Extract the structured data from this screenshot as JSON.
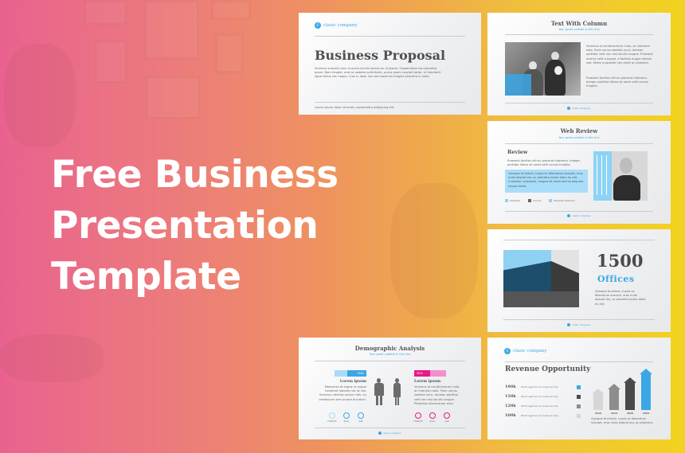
{
  "hero": {
    "title_lines": [
      "Free Business",
      "Presentation",
      "Template"
    ]
  },
  "colors": {
    "accent_blue": "#3ba7e5",
    "accent_pink": "#e8198b",
    "gradient_start": "#e9628f",
    "gradient_end": "#f2d21f"
  },
  "slides": {
    "business_proposal": {
      "logo_text": "clasic company",
      "title": "Business Proposal",
      "body": "Vivamus suscipit nunc ut purus iaculis lacinia eu ut ipsum. Suspendisse non pharetra quam. Nam feugiat, erat ac sodales sollicitudin, purus quam suscipit tortor, in hendrerit ligula tellus nec neque. Cras in dolor non est maximus fringilla pharetra in nulla.",
      "footer": "Lorem ipsum dolor sit amet, consectetur adipiscing elit."
    },
    "text_with_column": {
      "title": "Text With Column",
      "subtitle": "Your great subtitle in this line",
      "paragraph1": "Vivamus at condimentum nulla, ac interdum odio. Proin varius sodales nunc. Aenean porttitor velit non nisl iaculis congue. Praesent viverra velit a augue, a facilisis augue dictum sed. Etiam vulputate non amet ac pharetra.",
      "paragraph2": "Praesent facilisis elit eu placerat interdum. Integer porttitor libero sit amet velit cursus fringilla.",
      "footer_logo": "clasic company"
    },
    "web_review": {
      "title": "Web Review",
      "subtitle": "Your great subtitle in this line",
      "heading": "Review",
      "intro": "Praesent facilisis elit eu placerat interdum. Integer porttitor libero sit amet velit cursus fringilla.",
      "highlight": "Quisque tincidunt, turpis ac bibendum suscipit, eros nulla aliquet dui, ac pharetra lorem diam eu elit. Curabitur vulputate, magna sit amet lacinia aliquam, neque tortor.",
      "legend": [
        "Praesent",
        "Cursus",
        "Placerat interdum"
      ],
      "footer_logo": "clasic company"
    },
    "offices": {
      "number": "1500",
      "label": "Offices",
      "body": "Quisque tincidunt, turpis ac bibendum suscipit, eros nulla aliquet dui, ac pharetra lorem dolor eu elit.",
      "footer_logo": "clasic company"
    },
    "demographic": {
      "title": "Demographic Analysis",
      "subtitle": "Your great subtitle in this line",
      "left": {
        "percent_label": "60%",
        "percent_value": 60,
        "heading": "Lorem ipsum",
        "body": "Maecenas et augue ut augue hendrerit lobortis nec ac est. Vivamus ultricies auctor nibh, eu vestibulum sem ornare tincidunt.",
        "rings": [
          "FINANCE",
          "SKILL",
          "AGE"
        ]
      },
      "right": {
        "percent_label": "50%",
        "percent_value": 50,
        "heading": "Lorem ipsum",
        "body": "Vivamus at condimentum nulla, ac interdum odio. Proin varius sodales nunc. Aenean porttitor velit non nisl iaculis congue. Phasellus ullamcorper eros.",
        "rings": [
          "FINANCE",
          "SKILL",
          "AGE"
        ]
      },
      "footer_logo": "clasic company"
    },
    "revenue": {
      "logo_text": "clasic company",
      "title": "Revenue Opportunity",
      "rows": [
        {
          "value": "190k",
          "text": "Morbi eget leo ac turpis lacinia.",
          "color": "#3ba7e5"
        },
        {
          "value": "150k",
          "text": "Morbi eget leo ac turpis lacinia.",
          "color": "#4a4a4a"
        },
        {
          "value": "120k",
          "text": "Morbi eget leo ac turpis lacinia.",
          "color": "#8d8d8d"
        },
        {
          "value": "100k",
          "text": "Morbi eget leo ac turpis lacinia.",
          "color": "#d6d6d6"
        }
      ],
      "bars": [
        {
          "year": "2018",
          "value": 100,
          "color": "#d6d6d6"
        },
        {
          "year": "2019",
          "value": 120,
          "color": "#8d8d8d"
        },
        {
          "year": "2020",
          "value": 150,
          "color": "#4a4a4a"
        },
        {
          "year": "2020",
          "value": 190,
          "color": "#3ba7e5"
        }
      ],
      "caption": "Quisque tincidunt, turpis ac bibendum suscipit, eros nulla aliquet dui, ac pharetra."
    }
  }
}
